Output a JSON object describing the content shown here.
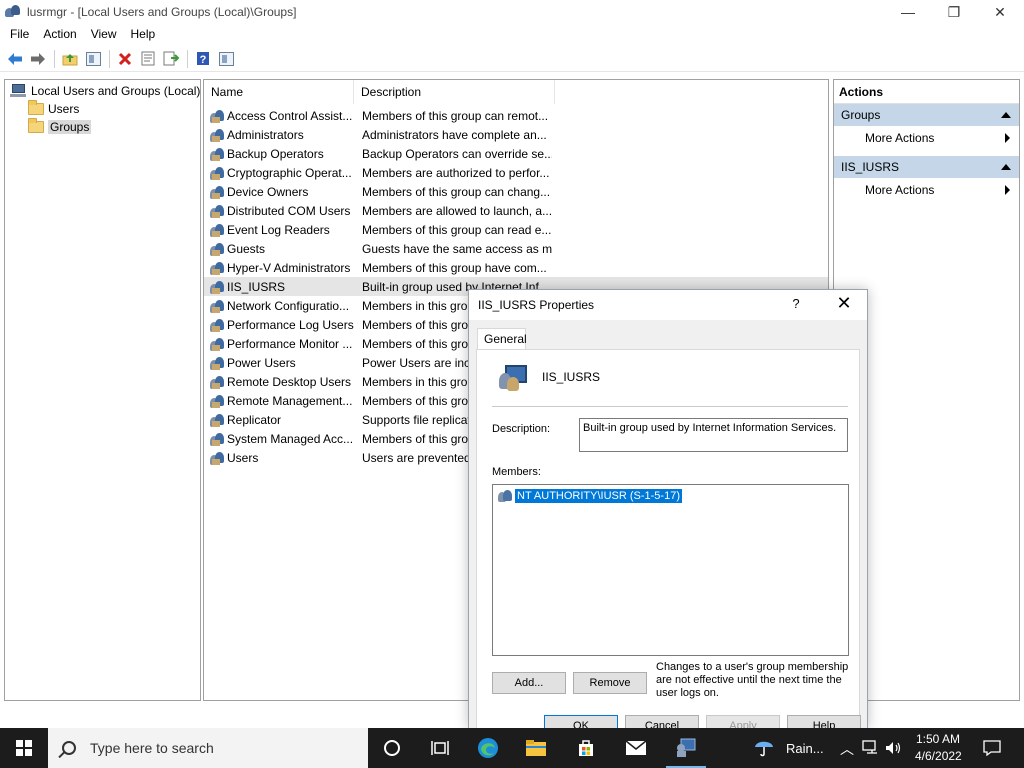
{
  "window": {
    "title": "lusrmgr - [Local Users and Groups (Local)\\Groups]",
    "controls": {
      "minimize": "—",
      "restore": "❐",
      "close": "✕"
    }
  },
  "menu": [
    "File",
    "Action",
    "View",
    "Help"
  ],
  "toolbar": {
    "buttons": [
      "back-arrow-icon",
      "forward-arrow-icon",
      "up-folder-icon",
      "show-hide-tree-icon",
      "delete-icon",
      "properties-icon",
      "export-list-icon",
      "help-icon",
      "show-hide-action-pane-icon"
    ]
  },
  "tree": {
    "root": "Local Users and Groups (Local)",
    "children": [
      "Users",
      "Groups"
    ],
    "selected": "Groups"
  },
  "list": {
    "columns": {
      "name": "Name",
      "description": "Description"
    },
    "rows": [
      {
        "name": "Access Control Assist...",
        "description": "Members of this group can remot..."
      },
      {
        "name": "Administrators",
        "description": "Administrators have complete an..."
      },
      {
        "name": "Backup Operators",
        "description": "Backup Operators can override se..."
      },
      {
        "name": "Cryptographic Operat...",
        "description": "Members are authorized to perfor..."
      },
      {
        "name": "Device Owners",
        "description": "Members of this group can chang..."
      },
      {
        "name": "Distributed COM Users",
        "description": "Members are allowed to launch, a..."
      },
      {
        "name": "Event Log Readers",
        "description": "Members of this group can read e..."
      },
      {
        "name": "Guests",
        "description": "Guests have the same access as m..."
      },
      {
        "name": "Hyper-V Administrators",
        "description": "Members of this group have com..."
      },
      {
        "name": "IIS_IUSRS",
        "description": "Built-in group used by Internet Inf..."
      },
      {
        "name": "Network Configuratio...",
        "description": "Members in this grou"
      },
      {
        "name": "Performance Log Users",
        "description": "Members of this grou"
      },
      {
        "name": "Performance Monitor ...",
        "description": "Members of this grou"
      },
      {
        "name": "Power Users",
        "description": "Power Users are inclu"
      },
      {
        "name": "Remote Desktop Users",
        "description": "Members in this grou"
      },
      {
        "name": "Remote Management...",
        "description": "Members of this grou"
      },
      {
        "name": "Replicator",
        "description": "Supports file replicat"
      },
      {
        "name": "System Managed Acc...",
        "description": "Members of this grou"
      },
      {
        "name": "Users",
        "description": "Users are prevented f"
      }
    ],
    "selected": "IIS_IUSRS"
  },
  "actions": {
    "title": "Actions",
    "sections": [
      {
        "header": "Groups",
        "item": "More Actions"
      },
      {
        "header": "IIS_IUSRS",
        "item": "More Actions"
      }
    ]
  },
  "dialog": {
    "title": "IIS_IUSRS Properties",
    "help": "?",
    "close": "✕",
    "tab": "General",
    "group_name": "IIS_IUSRS",
    "description_label": "Description:",
    "description_value": "Built-in group used by Internet Information Services.",
    "members_label": "Members:",
    "members": [
      "NT AUTHORITY\\IUSR (S-1-5-17)"
    ],
    "add_button": "Add...",
    "remove_button": "Remove",
    "note": "Changes to a user's group membership are not effective until the next time the user logs on.",
    "ok": "OK",
    "cancel": "Cancel",
    "apply": "Apply",
    "help_button": "Help"
  },
  "taskbar": {
    "search_placeholder": "Type here to search",
    "weather": "Rain...",
    "time": "1:50 AM",
    "date": "4/6/2022",
    "icons": [
      "task-view-icon",
      "timeline-icon",
      "edge-icon",
      "file-explorer-icon",
      "store-icon",
      "mail-icon",
      "lusrmgr-app-icon"
    ]
  }
}
